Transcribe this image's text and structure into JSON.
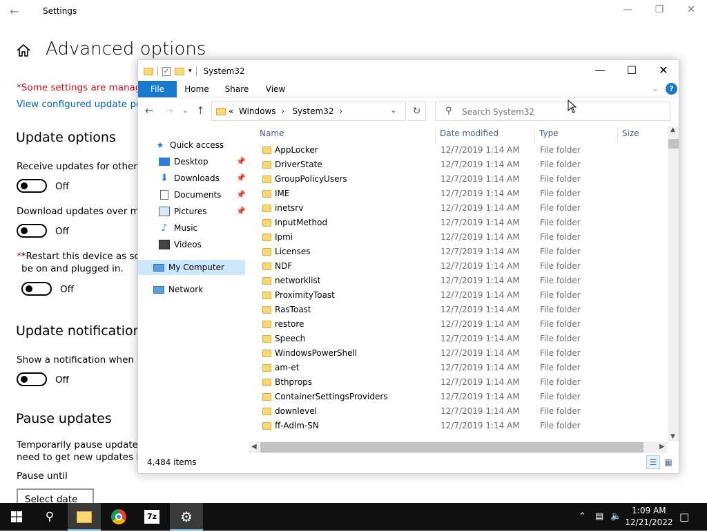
{
  "settings": {
    "title": "Settings",
    "heading": "Advanced options",
    "managed_notice": "*Some settings are managed",
    "policies_link": "View configured update poli",
    "update_options": {
      "heading": "Update options",
      "receive_label": "Receive updates for other M",
      "receive_state": "Off",
      "metered_label": "Download updates over met",
      "metered_state": "Off",
      "restart_line1": "*Restart this device as soon",
      "restart_line2": "be on and plugged in.",
      "restart_state": "Off"
    },
    "notifications": {
      "heading": "Update notifications",
      "show_label": "Show a notification when yo",
      "show_state": "Off"
    },
    "pause": {
      "heading": "Pause updates",
      "desc_line1": "Temporarily pause updates f",
      "desc_line2": "need to get new updates be",
      "until_label": "Pause until",
      "select_value": "Select date"
    }
  },
  "explorer": {
    "title": "System32",
    "ribbon_tabs": [
      "File",
      "Home",
      "Share",
      "View"
    ],
    "address": {
      "prefix": "«",
      "crumb1": "Windows",
      "crumb2": "System32"
    },
    "search_placeholder": "Search System32",
    "nav": {
      "quick_access": "Quick access",
      "desktop": "Desktop",
      "downloads": "Downloads",
      "documents": "Documents",
      "pictures": "Pictures",
      "music": "Music",
      "videos": "Videos",
      "my_computer": "My Computer",
      "network": "Network"
    },
    "columns": {
      "name": "Name",
      "date": "Date modified",
      "type": "Type",
      "size": "Size"
    },
    "files": [
      {
        "name": "AppLocker",
        "date": "12/7/2019 1:14 AM",
        "type": "File folder"
      },
      {
        "name": "DriverState",
        "date": "12/7/2019 1:14 AM",
        "type": "File folder"
      },
      {
        "name": "GroupPolicyUsers",
        "date": "12/7/2019 1:14 AM",
        "type": "File folder"
      },
      {
        "name": "IME",
        "date": "12/7/2019 1:14 AM",
        "type": "File folder"
      },
      {
        "name": "inetsrv",
        "date": "12/7/2019 1:14 AM",
        "type": "File folder"
      },
      {
        "name": "InputMethod",
        "date": "12/7/2019 1:14 AM",
        "type": "File folder"
      },
      {
        "name": "Ipmi",
        "date": "12/7/2019 1:14 AM",
        "type": "File folder"
      },
      {
        "name": "Licenses",
        "date": "12/7/2019 1:14 AM",
        "type": "File folder"
      },
      {
        "name": "NDF",
        "date": "12/7/2019 1:14 AM",
        "type": "File folder"
      },
      {
        "name": "networklist",
        "date": "12/7/2019 1:14 AM",
        "type": "File folder"
      },
      {
        "name": "ProximityToast",
        "date": "12/7/2019 1:14 AM",
        "type": "File folder"
      },
      {
        "name": "RasToast",
        "date": "12/7/2019 1:14 AM",
        "type": "File folder"
      },
      {
        "name": "restore",
        "date": "12/7/2019 1:14 AM",
        "type": "File folder"
      },
      {
        "name": "Speech",
        "date": "12/7/2019 1:14 AM",
        "type": "File folder"
      },
      {
        "name": "WindowsPowerShell",
        "date": "12/7/2019 1:14 AM",
        "type": "File folder"
      },
      {
        "name": "am-et",
        "date": "12/7/2019 1:14 AM",
        "type": "File folder"
      },
      {
        "name": "Bthprops",
        "date": "12/7/2019 1:14 AM",
        "type": "File folder"
      },
      {
        "name": "ContainerSettingsProviders",
        "date": "12/7/2019 1:14 AM",
        "type": "File folder"
      },
      {
        "name": "downlevel",
        "date": "12/7/2019 1:14 AM",
        "type": "File folder"
      },
      {
        "name": "ff-Adlm-SN",
        "date": "12/7/2019 1:14 AM",
        "type": "File folder"
      }
    ],
    "status_count": "4,484 items"
  },
  "taskbar": {
    "time": "1:09 AM",
    "date": "12/21/2022",
    "seven_zip_label": "7z"
  },
  "icons": {
    "folder_color": "#f8d775",
    "accent": "#1979ca"
  }
}
